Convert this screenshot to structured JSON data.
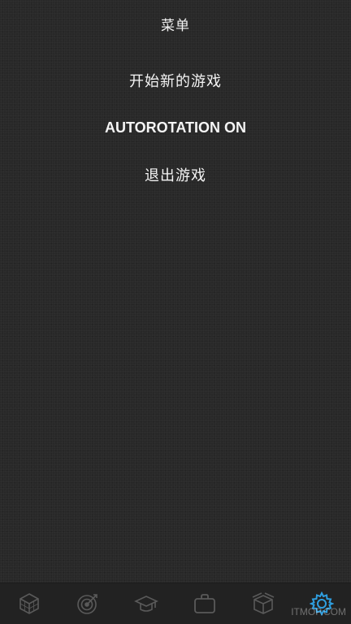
{
  "header": {
    "title": "菜单"
  },
  "menu": {
    "items": [
      {
        "label": "开始新的游戏"
      },
      {
        "label": "AUTOROTATION ON"
      },
      {
        "label": "退出游戏"
      }
    ]
  },
  "tabbar": {
    "icons": [
      "cube-icon",
      "target-icon",
      "graduation-cap-icon",
      "briefcase-icon",
      "box-icon",
      "gear-icon"
    ],
    "active_color": "#2f9fe0",
    "inactive_color": "#5a5a5a"
  },
  "watermark": {
    "text": "ITMOP.COM"
  }
}
